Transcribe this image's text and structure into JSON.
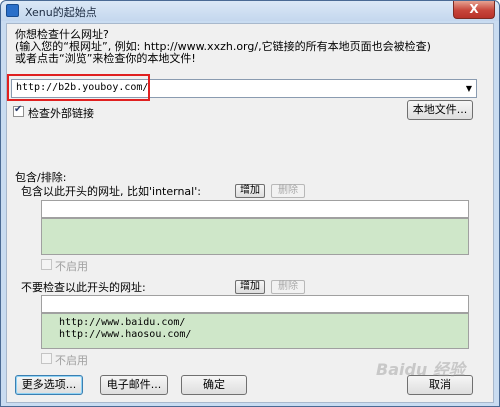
{
  "window": {
    "title": "Xenu的起始点",
    "close_label": "X"
  },
  "prompt": {
    "line1": "你想检查什么网址?",
    "line2": "(输入您的“根网址”, 例如: http://www.xxzh.org/,它链接的所有本地页面也会被检查)",
    "line3": "或者点击“浏览”来检查你的本地文件!"
  },
  "url": {
    "value": "http://b2b.youboy.com/"
  },
  "check_external": {
    "label": "检查外部链接",
    "checked": true
  },
  "local_file_button": "本地文件...",
  "include_exclude": {
    "title": "包含/排除:",
    "include": {
      "label": "包含以此开头的网址, 比如'internal':",
      "add_button": "增加",
      "remove_button": "删除",
      "items": [],
      "disable_label": "不启用"
    },
    "exclude": {
      "label": "不要检查以此开头的网址:",
      "add_button": "增加",
      "remove_button": "删除",
      "items": [
        "http://www.baidu.com/",
        "http://www.haosou.com/"
      ],
      "disable_label": "不启用"
    }
  },
  "footer": {
    "more_options": "更多选项...",
    "email": "电子邮件...",
    "ok": "确定",
    "cancel": "取消"
  },
  "watermark": "Baidu 经验"
}
